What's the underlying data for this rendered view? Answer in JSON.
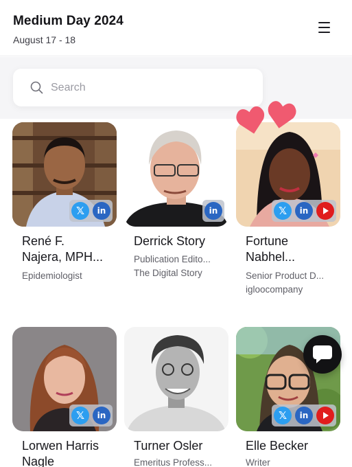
{
  "header": {
    "title": "Medium Day 2024",
    "dates": "August 17 - 18"
  },
  "search": {
    "placeholder": "Search"
  },
  "icons": {
    "menu": "hamburger-menu-icon",
    "search": "magnifier-icon",
    "twitter": "x-twitter-icon",
    "linkedin": "linkedin-icon",
    "youtube": "youtube-icon",
    "chat": "chat-bubble-icon",
    "hearts": "hearts-decoration-icon"
  },
  "social_labels": {
    "x": "𝕏",
    "linkedin": "in"
  },
  "colors": {
    "twitter": "#2c9ef0",
    "linkedin": "#2a66c2",
    "youtube": "#e01d1d",
    "heart": "#f05a70",
    "chat": "#121214"
  },
  "speakers": [
    {
      "name_line1": "René F.",
      "name_line2": "Najera, MPH...",
      "role": "Epidemiologist",
      "company": ""
    },
    {
      "name_line1": "Derrick Story",
      "name_line2": "",
      "role": "Publication Edito...",
      "company": "The Digital Story"
    },
    {
      "name_line1": "Fortune",
      "name_line2": "Nabhel...",
      "role": "Senior Product D...",
      "company": "igloocompany"
    },
    {
      "name_line1": "Lorwen Harris",
      "name_line2": "Nagle",
      "role": "",
      "company": ""
    },
    {
      "name_line1": "Turner Osler",
      "name_line2": "",
      "role": "Emeritus Profess...",
      "company": ""
    },
    {
      "name_line1": "Elle Becker",
      "name_line2": "",
      "role": "Writer",
      "company": ""
    }
  ]
}
